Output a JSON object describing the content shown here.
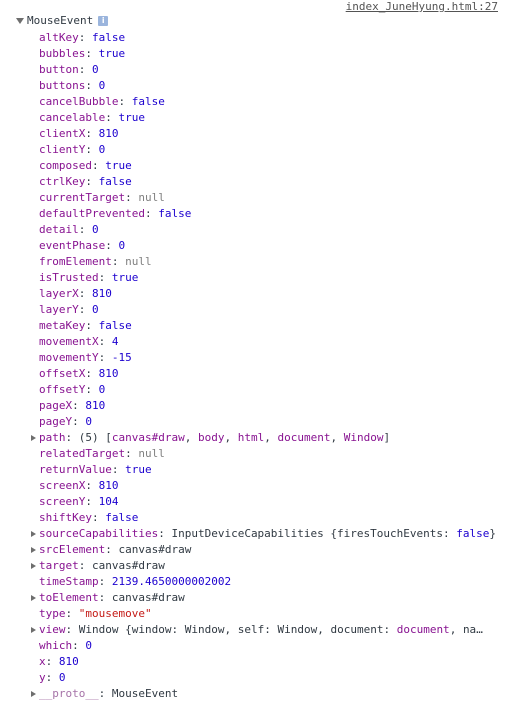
{
  "source": "index_JuneHyung.html:27",
  "root_label": "MouseEvent",
  "info_icon": "i",
  "properties": [
    {
      "key": "altKey",
      "value": "false",
      "type": "bool",
      "expandable": false
    },
    {
      "key": "bubbles",
      "value": "true",
      "type": "bool",
      "expandable": false
    },
    {
      "key": "button",
      "value": "0",
      "type": "num",
      "expandable": false
    },
    {
      "key": "buttons",
      "value": "0",
      "type": "num",
      "expandable": false
    },
    {
      "key": "cancelBubble",
      "value": "false",
      "type": "bool",
      "expandable": false
    },
    {
      "key": "cancelable",
      "value": "true",
      "type": "bool",
      "expandable": false
    },
    {
      "key": "clientX",
      "value": "810",
      "type": "num",
      "expandable": false
    },
    {
      "key": "clientY",
      "value": "0",
      "type": "num",
      "expandable": false
    },
    {
      "key": "composed",
      "value": "true",
      "type": "bool",
      "expandable": false
    },
    {
      "key": "ctrlKey",
      "value": "false",
      "type": "bool",
      "expandable": false
    },
    {
      "key": "currentTarget",
      "value": "null",
      "type": "null",
      "expandable": false
    },
    {
      "key": "defaultPrevented",
      "value": "false",
      "type": "bool",
      "expandable": false
    },
    {
      "key": "detail",
      "value": "0",
      "type": "num",
      "expandable": false
    },
    {
      "key": "eventPhase",
      "value": "0",
      "type": "num",
      "expandable": false
    },
    {
      "key": "fromElement",
      "value": "null",
      "type": "null",
      "expandable": false
    },
    {
      "key": "isTrusted",
      "value": "true",
      "type": "bool",
      "expandable": false
    },
    {
      "key": "layerX",
      "value": "810",
      "type": "num",
      "expandable": false
    },
    {
      "key": "layerY",
      "value": "0",
      "type": "num",
      "expandable": false
    },
    {
      "key": "metaKey",
      "value": "false",
      "type": "bool",
      "expandable": false
    },
    {
      "key": "movementX",
      "value": "4",
      "type": "num",
      "expandable": false
    },
    {
      "key": "movementY",
      "value": "-15",
      "type": "num",
      "expandable": false
    },
    {
      "key": "offsetX",
      "value": "810",
      "type": "num",
      "expandable": false
    },
    {
      "key": "offsetY",
      "value": "0",
      "type": "num",
      "expandable": false
    },
    {
      "key": "pageX",
      "value": "810",
      "type": "num",
      "expandable": false
    },
    {
      "key": "pageY",
      "value": "0",
      "type": "num",
      "expandable": false
    },
    {
      "key": "path",
      "value": "(5) [canvas#draw, body, html, document, Window]",
      "type": "path",
      "expandable": true
    },
    {
      "key": "relatedTarget",
      "value": "null",
      "type": "null",
      "expandable": false
    },
    {
      "key": "returnValue",
      "value": "true",
      "type": "bool",
      "expandable": false
    },
    {
      "key": "screenX",
      "value": "810",
      "type": "num",
      "expandable": false
    },
    {
      "key": "screenY",
      "value": "104",
      "type": "num",
      "expandable": false
    },
    {
      "key": "shiftKey",
      "value": "false",
      "type": "bool",
      "expandable": false
    },
    {
      "key": "sourceCapabilities",
      "value": "InputDeviceCapabilities {firesTouchEvents: false}",
      "type": "caps",
      "expandable": true
    },
    {
      "key": "srcElement",
      "value": "canvas#draw",
      "type": "obj",
      "expandable": true
    },
    {
      "key": "target",
      "value": "canvas#draw",
      "type": "obj",
      "expandable": true
    },
    {
      "key": "timeStamp",
      "value": "2139.4650000002002",
      "type": "num",
      "expandable": false
    },
    {
      "key": "toElement",
      "value": "canvas#draw",
      "type": "obj",
      "expandable": true
    },
    {
      "key": "type",
      "value": "\"mousemove\"",
      "type": "str",
      "expandable": false
    },
    {
      "key": "view",
      "value": "Window {window: Window, self: Window, document: document, name: …",
      "type": "obj",
      "expandable": true
    },
    {
      "key": "which",
      "value": "0",
      "type": "num",
      "expandable": false
    },
    {
      "key": "x",
      "value": "810",
      "type": "num",
      "expandable": false
    },
    {
      "key": "y",
      "value": "0",
      "type": "num",
      "expandable": false
    },
    {
      "key": "__proto__",
      "value": "MouseEvent",
      "type": "obj",
      "expandable": true,
      "proto": true
    }
  ]
}
